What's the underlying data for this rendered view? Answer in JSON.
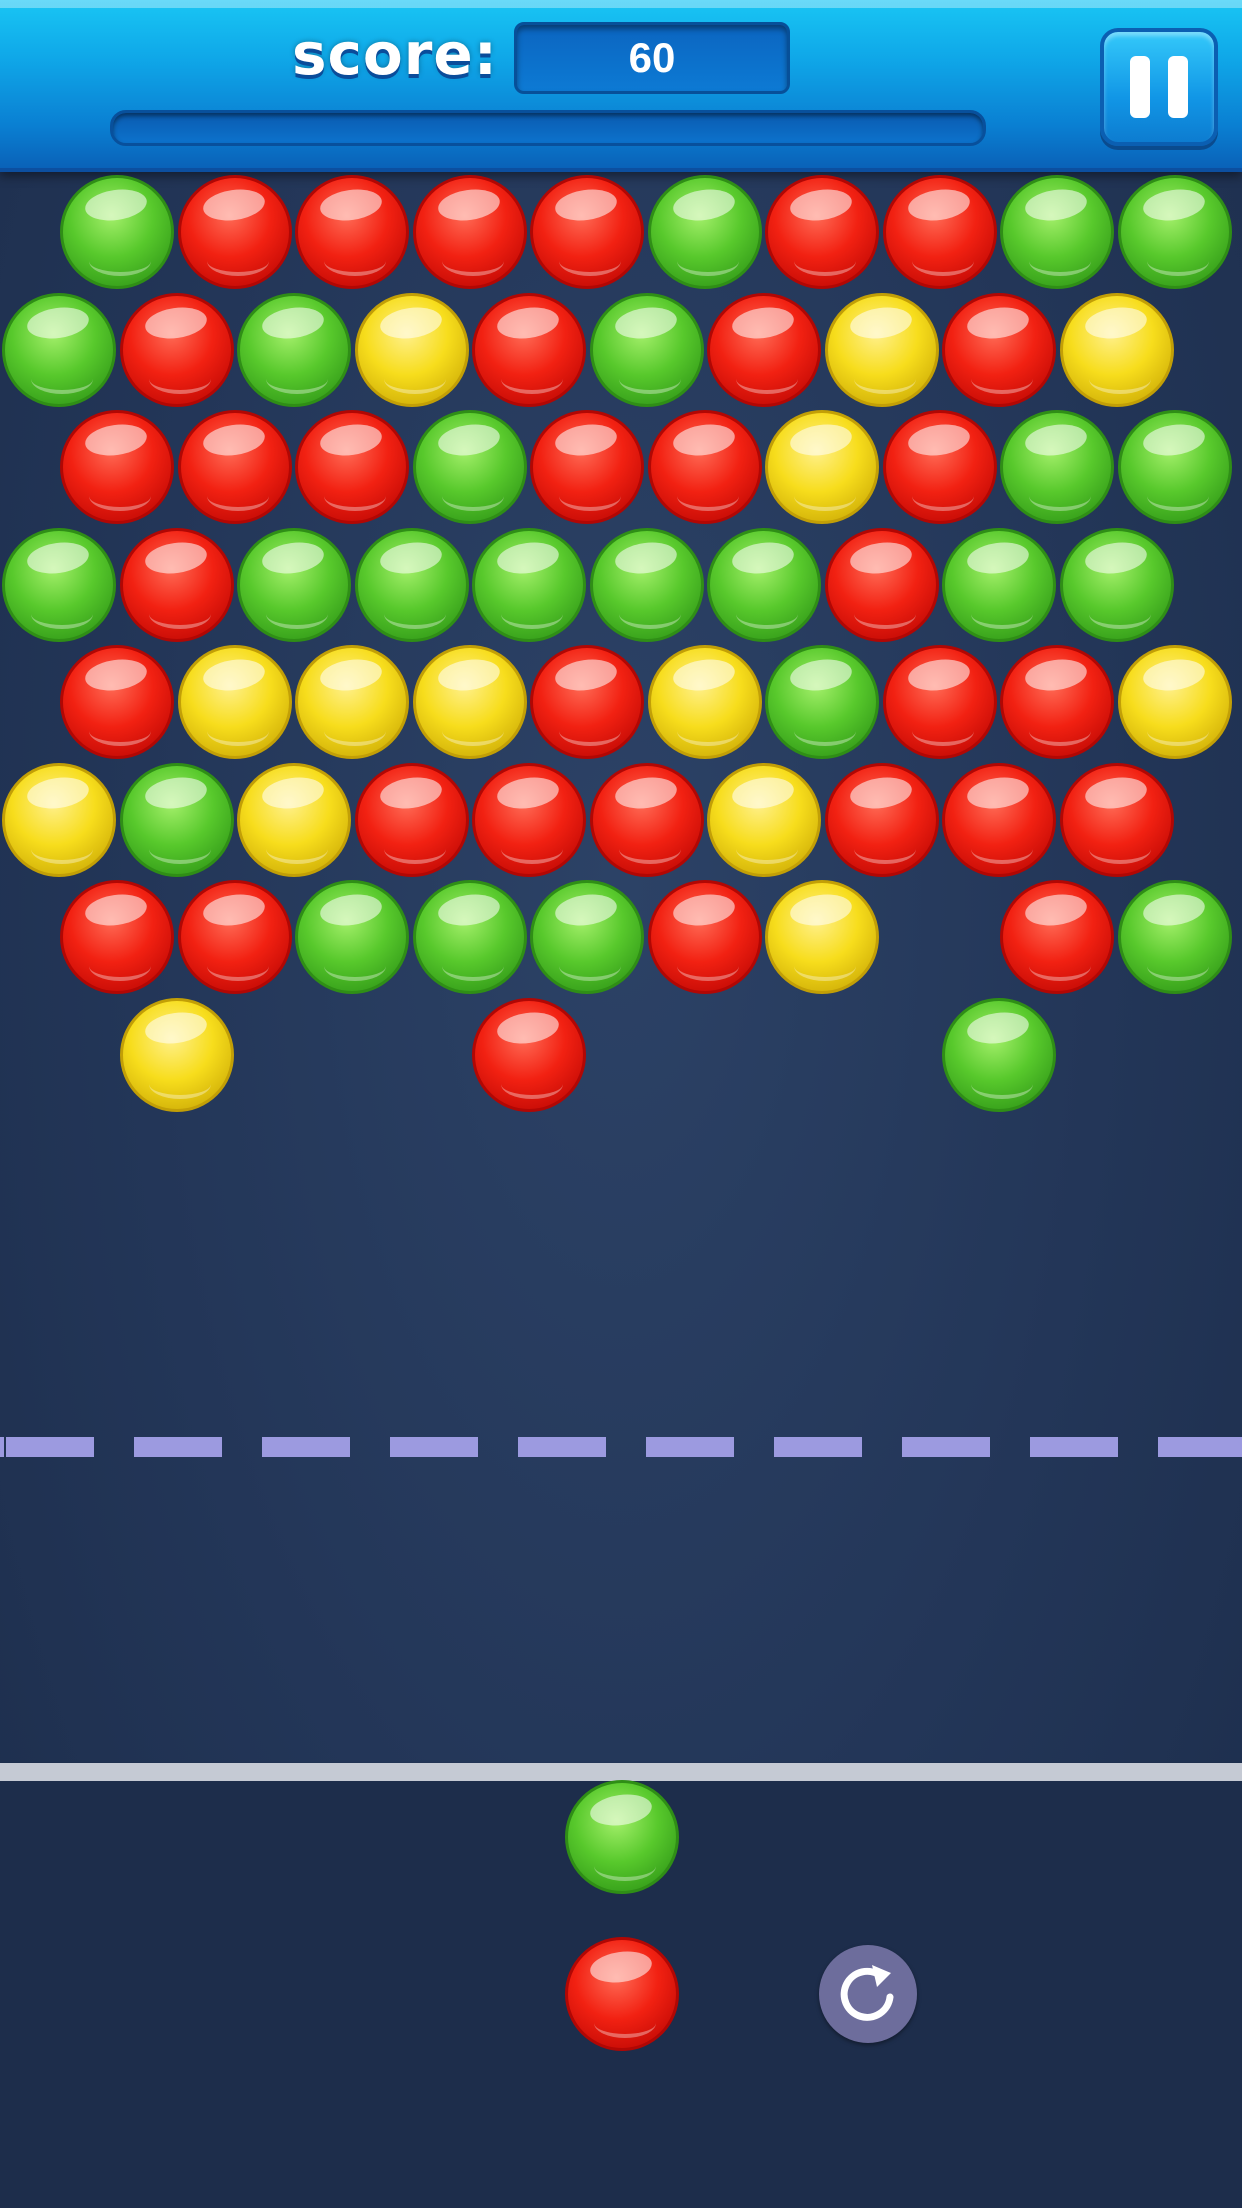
{
  "hud": {
    "score_label": "score:",
    "score_value": "60",
    "progress": 0,
    "pause_icon": "pause-icon"
  },
  "colors": {
    "red": "#f22112",
    "green": "#58c92c",
    "yellow": "#f7dd1c",
    "hud_blue": "#0fa7e8",
    "dashed_line": "#9c9ae0"
  },
  "board": {
    "rows": [
      [
        "green",
        "red",
        "red",
        "red",
        "red",
        "green",
        "red",
        "red",
        "green",
        "green"
      ],
      [
        "green",
        "red",
        "green",
        "yellow",
        "red",
        "green",
        "red",
        "yellow",
        "red",
        "yellow"
      ],
      [
        "red",
        "red",
        "red",
        "green",
        "red",
        "red",
        "yellow",
        "red",
        "green",
        "green"
      ],
      [
        "green",
        "red",
        "green",
        "green",
        "green",
        "green",
        "green",
        "red",
        "green",
        "green"
      ],
      [
        "red",
        "yellow",
        "yellow",
        "yellow",
        "red",
        "yellow",
        "green",
        "red",
        "red",
        "yellow"
      ],
      [
        "yellow",
        "green",
        "yellow",
        "red",
        "red",
        "red",
        "yellow",
        "red",
        "red",
        "red"
      ],
      [
        "red",
        "red",
        "green",
        "green",
        "green",
        "red",
        "yellow",
        null,
        "red",
        "green"
      ],
      [
        null,
        "yellow",
        null,
        null,
        "red",
        null,
        null,
        null,
        "green",
        null
      ]
    ]
  },
  "shooter": {
    "current": "green",
    "next": "red",
    "swap_icon": "swap-refresh-icon"
  }
}
